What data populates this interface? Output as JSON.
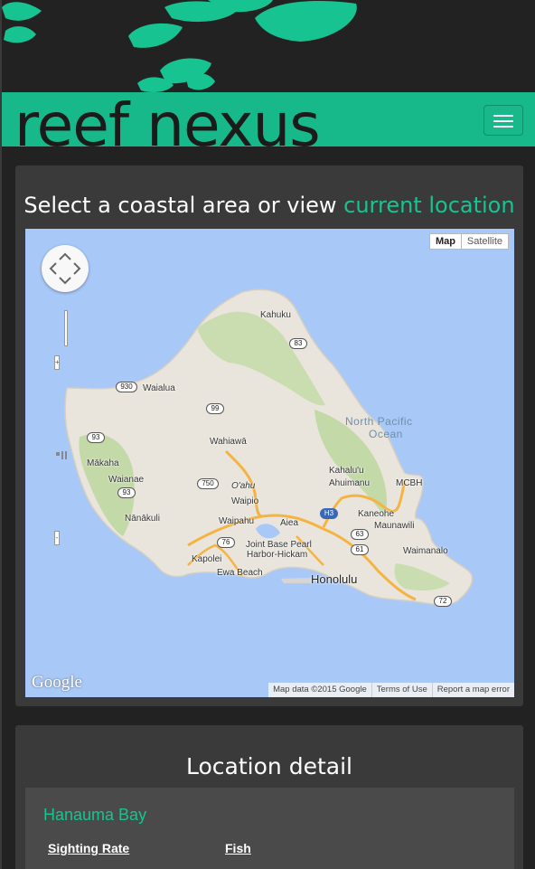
{
  "brand": {
    "name": "reef nexus",
    "accent_color": "#17b98a"
  },
  "nav": {
    "toggle_icon": "hamburger-icon"
  },
  "map_panel": {
    "title_prefix": "Select a coastal area or view ",
    "title_link": "current location",
    "map": {
      "type_buttons": {
        "map": "Map",
        "satellite": "Satellite"
      },
      "logo": "Google",
      "attribution": {
        "data": "Map data ©2015 Google",
        "terms": "Terms of Use",
        "report": "Report a map error"
      },
      "labels": {
        "kahuku": "Kahuku",
        "waialua": "Waialua",
        "wahiawa": "Wahiawā",
        "makaha": "Mākaha",
        "waianae": "Waianae",
        "nanakuli": "Nānākuli",
        "oahu": "O'ahu",
        "waipio": "Waipio",
        "waipahu": "Waipahu",
        "aiea": "Aiea",
        "kapolei": "Kapolei",
        "ewa": "Ewa Beach",
        "jbph1": "Joint Base Pearl",
        "jbph2": "Harbor-Hickam",
        "honolulu": "Honolulu",
        "kaneohe": "Kaneohe",
        "kahaluu1": "Kahalu'u",
        "kahaluu2": "Ahuimanu",
        "maunawili": "Maunawili",
        "waimanalo": "Waimanalo",
        "mcbh": "MCBH",
        "ocean1": "North Pacific",
        "ocean2": "Ocean"
      },
      "shields": {
        "s83": "83",
        "s930": "930",
        "s99": "99",
        "s93a": "93",
        "s93b": "93",
        "s750": "750",
        "s76": "76",
        "s63": "63",
        "s61": "61",
        "s72": "72",
        "sh3": "H3"
      }
    }
  },
  "detail_panel": {
    "title": "Location detail",
    "location_name": "Hanauma Bay",
    "columns": {
      "sighting_rate": "Sighting Rate",
      "fish": "Fish"
    }
  }
}
